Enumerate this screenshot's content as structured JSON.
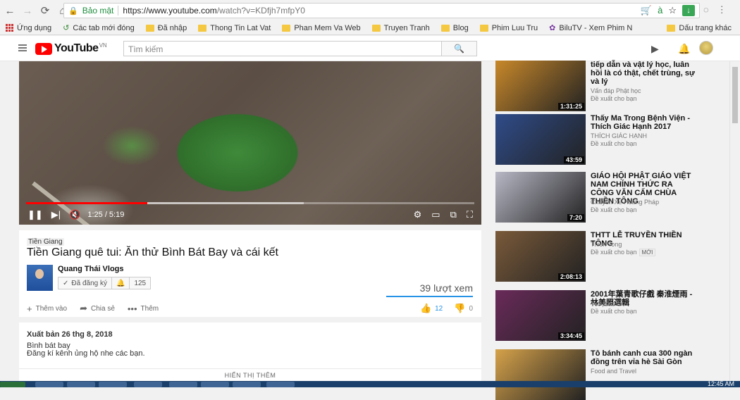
{
  "browser": {
    "secure_label": "Bảo mật",
    "url_host": "https://www.youtube.com",
    "url_path": "/watch?v=KDfjh7mfpY0"
  },
  "bookmarks": {
    "items": [
      "Ứng dụng",
      "Các tab mới đóng",
      "Đã nhập",
      "Thong Tin Lat Vat",
      "Phan Mem Va Web",
      "Truyen Tranh",
      "Blog",
      "Phim Luu Tru",
      "BiluTV - Xem Phim N"
    ],
    "other": "Dấu trang khác"
  },
  "header": {
    "logo_text": "YouTube",
    "region": "VN",
    "search_placeholder": "Tìm kiếm"
  },
  "player": {
    "time": "1:25 / 5:19",
    "progress": 0.27,
    "buffered": 0.62
  },
  "video": {
    "tag": "Tiền Giang",
    "title": "Tiền Giang quê tui: Ăn thử Bình Bát Bay và cái kết",
    "channel": "Quang Thái Vlogs",
    "subscribed_label": "Đã đăng ký",
    "sub_count": "125",
    "views": "39 lượt xem",
    "add_to": "Thêm vào",
    "share": "Chia sẻ",
    "more": "Thêm",
    "likes": "12",
    "dislikes": "0"
  },
  "description": {
    "published": "Xuất bản 26 thg 8, 2018",
    "line1": "Bình bát bay",
    "line2": "Đăng kí kênh ủng hộ nhe các bạn.",
    "show_more": "HIỂN THỊ THÊM"
  },
  "sidebar": [
    {
      "title": "tiếp dẫn và vật lý học, luân hồi là có thật, chết trùng, sự và lý",
      "channel": "Vấn đáp Phật học",
      "meta": "Đề xuất cho bạn",
      "duration": "1:31:25",
      "color": "#c8882a"
    },
    {
      "title": "Thấy Ma Trong Bệnh Viện - Thích Giác Hạnh 2017",
      "channel": "THÍCH GIÁC HẠNH",
      "meta": "Đề xuất cho bạn",
      "duration": "43:59",
      "color": "#2f4c8a"
    },
    {
      "title": "GIÁO HỘI PHẬT GIÁO VIỆT NAM CHÍNH THỨC RA CÔNG VĂN CẤM CHÙA THIỀN TÔNG",
      "channel": "Chuyển Xe Hoằng Pháp",
      "meta": "Đề xuất cho bạn",
      "duration": "7:20",
      "color": "#b8b8c6"
    },
    {
      "title": "THTT LỄ TRUYỀN THIỀN TÔNG",
      "channel": "Thien Tong",
      "meta": "Đề xuất cho bạn",
      "badge": "MỚI",
      "duration": "2:08:13",
      "color": "#7a5a3a"
    },
    {
      "title": "2001年葉青歌仔戲 秦淮煙雨 - 林美照選輯",
      "channel": "Twopera fan",
      "meta": "Đề xuất cho bạn",
      "duration": "3:34:45",
      "color": "#6a2a5a"
    },
    {
      "title": "Tô bánh canh cua 300 ngàn đồng trên vỉa hè Sài Gòn",
      "channel": "Food and Travel",
      "meta": "",
      "duration": "",
      "color": "#d6a24a"
    }
  ],
  "taskbar": {
    "clock": "12:45 AM"
  },
  "icons": {
    "back": "←",
    "forward": "→",
    "reload": "⟳",
    "home": "⌂",
    "star": "☆",
    "menu": "⋮",
    "search": "⚲",
    "camera": "▶",
    "bell": "🔔"
  }
}
